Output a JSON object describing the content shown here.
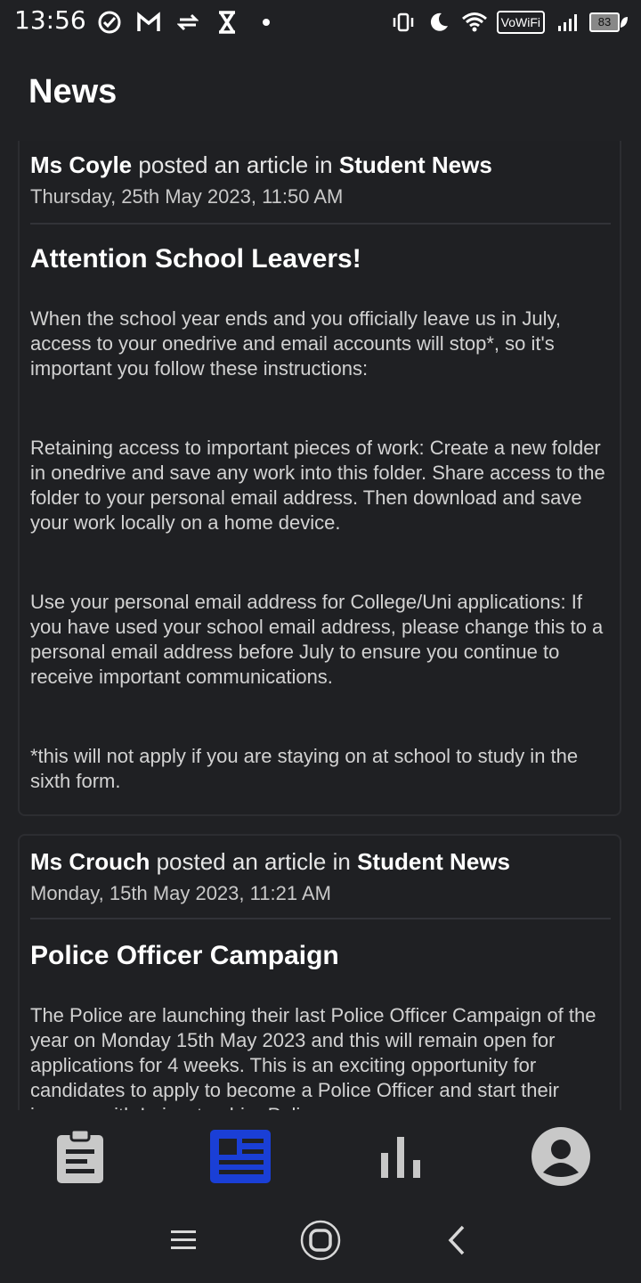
{
  "status_bar": {
    "time": "13:56",
    "left_icons": [
      "check-circle-icon",
      "gmail-icon",
      "data-transfer-icon",
      "hourglass-icon",
      "dot-icon"
    ],
    "vowifi": "VoWiFi",
    "battery": "83"
  },
  "header": {
    "title": "News"
  },
  "articles": [
    {
      "author": "Ms Coyle",
      "verb": "posted an article in",
      "channel": "Student News",
      "date": "Thursday, 25th May 2023, 11:50 AM",
      "title": "Attention School Leavers!",
      "paragraphs": [
        "When the school year ends and you officially leave us in July, access to your onedrive and email accounts will stop*, so it's important you follow these instructions:",
        "Retaining access to important pieces of work: Create a new folder in onedrive and save any work into this folder. Share access to the folder to your personal email address. Then download and save your work locally on a home device.",
        "Use your personal email address for College/Uni applications: If you have used your school email address, please change this to a personal email address before July to ensure you continue to receive important communications.",
        "*this will not apply if you are staying on at school to study in the sixth form."
      ]
    },
    {
      "author": "Ms Crouch",
      "verb": "posted an article in",
      "channel": "Student News",
      "date": "Monday, 15th May 2023, 11:21 AM",
      "title": "Police Officer Campaign",
      "paragraphs": [
        "The Police are launching their last Police Officer Campaign of the year on Monday 15th May 2023 and this will remain open for applications for 4 weeks.  This is an exciting opportunity for candidates to apply to become a Police Officer and start their journey with Leicestershire Police."
      ]
    }
  ],
  "bottom_nav": {
    "items": [
      {
        "icon": "clipboard-icon",
        "active": false
      },
      {
        "icon": "news-icon",
        "active": true
      },
      {
        "icon": "bar-chart-icon",
        "active": false
      },
      {
        "icon": "account-icon",
        "active": false
      }
    ],
    "active_color": "#1a3fd6",
    "inactive_color": "#c8c8c8"
  },
  "system_nav": [
    "recents-icon",
    "home-icon",
    "back-icon"
  ]
}
